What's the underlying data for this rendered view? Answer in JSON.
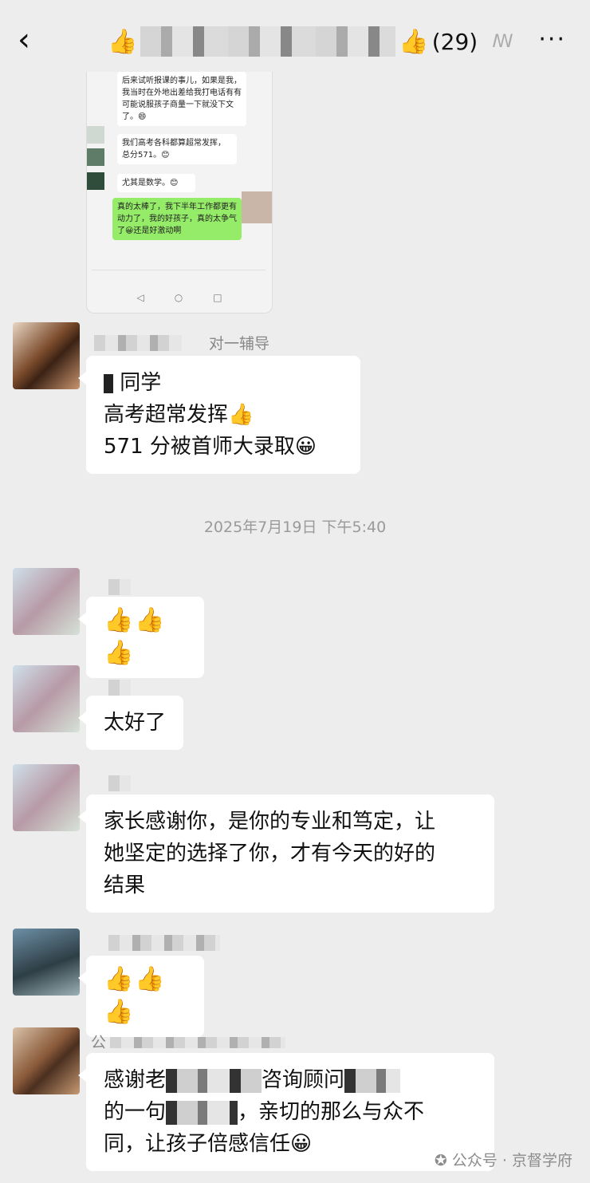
{
  "header": {
    "back_icon": "‹",
    "thumb_icon": "👍",
    "member_count": "(29)",
    "ear_icon": "ꟿ",
    "more_icon": "···"
  },
  "screenshot": {
    "messages": [
      "后来试听报课的事儿，如果是我，我当时在外地出差给我打电话有有可能说服孩子商量一下就没下文了。😄",
      "我们高考各科都算超常发挥，总分571。😊",
      "尤其是数学。😊",
      "真的太棒了，我下半年工作都更有动力了，我的好孩子，真的太争气了😀还是好激动啊"
    ],
    "nav": [
      "◁",
      "○",
      "□"
    ]
  },
  "chat": {
    "nick1_suffix": "对一辅导",
    "msg1_line1": "同学",
    "msg1_line2": "高考超常发挥👍",
    "msg1_line3": "571 分被首师大录取😀",
    "timestamp": "2025年7月19日 下午5:40",
    "msg2": "👍👍👍",
    "msg3": "太好了",
    "msg4_line1": "家长感谢你，是你的专业和笃定，让",
    "msg4_line2": "她坚定的选择了你，才有今天的好的",
    "msg4_line3": "结果",
    "msg5": "👍👍👍",
    "nick6_prefix": "公",
    "msg6_a": "感谢老",
    "msg6_b": "咨询顾问",
    "msg6_c": "的一句",
    "msg6_d": "，亲切的那么与众不",
    "msg6_e": "同，让孩子倍感信任😀"
  },
  "watermark": {
    "icon": "✪",
    "text": "公众号 · 京督学府"
  }
}
